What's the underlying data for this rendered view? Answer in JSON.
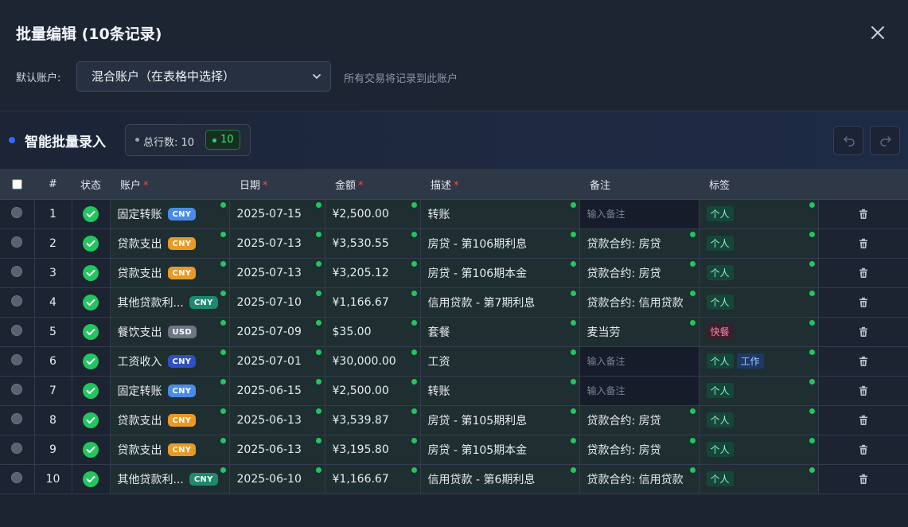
{
  "modal": {
    "title": "批量编辑 (10条记录)",
    "close_icon": "close-icon"
  },
  "account": {
    "label": "默认账户:",
    "selected": "混合账户（在表格中选择）",
    "hint": "所有交易将记录到此账户"
  },
  "toolbar": {
    "title": "智能批量录入",
    "total_label": "总行数: 10",
    "valid_count": "10",
    "undo_icon": "undo-icon",
    "redo_icon": "redo-icon"
  },
  "table": {
    "headers": {
      "index": "#",
      "status": "状态",
      "account": "账户",
      "date": "日期",
      "amount": "金额",
      "description": "描述",
      "note": "备注",
      "tags": "标签"
    },
    "required_mark": "*",
    "note_placeholder": "输入备注",
    "rows": [
      {
        "n": "1",
        "account": "固定转账",
        "cur": "CNY",
        "cur_color": "#4a8be6",
        "date": "2025-07-15",
        "amount": "¥2,500.00",
        "desc": "转账",
        "note": "",
        "tags": [
          "个人"
        ]
      },
      {
        "n": "2",
        "account": "贷款支出",
        "cur": "CNY",
        "cur_color": "#e89a24",
        "date": "2025-07-13",
        "amount": "¥3,530.55",
        "desc": "房贷 - 第106期利息",
        "note": "贷款合约: 房贷",
        "tags": [
          "个人"
        ]
      },
      {
        "n": "3",
        "account": "贷款支出",
        "cur": "CNY",
        "cur_color": "#e89a24",
        "date": "2025-07-13",
        "amount": "¥3,205.12",
        "desc": "房贷 - 第106期本金",
        "note": "贷款合约: 房贷",
        "tags": [
          "个人"
        ]
      },
      {
        "n": "4",
        "account": "其他贷款利...",
        "cur": "CNY",
        "cur_color": "#1d8a6e",
        "date": "2025-07-10",
        "amount": "¥1,166.67",
        "desc": "信用贷款 - 第7期利息",
        "note": "贷款合约: 信用贷款",
        "tags": [
          "个人"
        ]
      },
      {
        "n": "5",
        "account": "餐饮支出",
        "cur": "USD",
        "cur_color": "#6e7684",
        "date": "2025-07-09",
        "amount": "$35.00",
        "desc": "套餐",
        "note": "麦当劳",
        "tags": [
          "快餐"
        ]
      },
      {
        "n": "6",
        "account": "工资收入",
        "cur": "CNY",
        "cur_color": "#2f4fc4",
        "date": "2025-07-01",
        "amount": "¥30,000.00",
        "desc": "工资",
        "note": "",
        "tags": [
          "个人",
          "工作"
        ]
      },
      {
        "n": "7",
        "account": "固定转账",
        "cur": "CNY",
        "cur_color": "#4a8be6",
        "date": "2025-06-15",
        "amount": "¥2,500.00",
        "desc": "转账",
        "note": "",
        "tags": [
          "个人"
        ]
      },
      {
        "n": "8",
        "account": "贷款支出",
        "cur": "CNY",
        "cur_color": "#e89a24",
        "date": "2025-06-13",
        "amount": "¥3,539.87",
        "desc": "房贷 - 第105期利息",
        "note": "贷款合约: 房贷",
        "tags": [
          "个人"
        ]
      },
      {
        "n": "9",
        "account": "贷款支出",
        "cur": "CNY",
        "cur_color": "#e89a24",
        "date": "2025-06-13",
        "amount": "¥3,195.80",
        "desc": "房贷 - 第105期本金",
        "note": "贷款合约: 房贷",
        "tags": [
          "个人"
        ]
      },
      {
        "n": "10",
        "account": "其他贷款利...",
        "cur": "CNY",
        "cur_color": "#1d8a6e",
        "date": "2025-06-10",
        "amount": "¥1,166.67",
        "desc": "信用贷款 - 第6期利息",
        "note": "贷款合约: 信用贷款",
        "tags": [
          "个人"
        ]
      }
    ]
  },
  "colors": {
    "valid": "#22c55e",
    "accent": "#2f6df5",
    "required": "#ef4d4d"
  }
}
